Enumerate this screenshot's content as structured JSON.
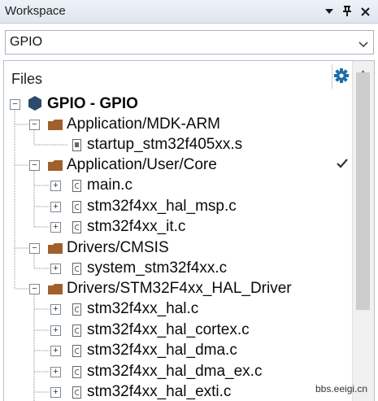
{
  "window": {
    "title": "Workspace"
  },
  "selector": {
    "value": "GPIO"
  },
  "tree": {
    "header": "Files",
    "root": "GPIO - GPIO",
    "groups": [
      {
        "label": "Application/MDK-ARM",
        "files": [
          "startup_stm32f405xx.s"
        ]
      },
      {
        "label": "Application/User/Core",
        "files": [
          "main.c",
          "stm32f4xx_hal_msp.c",
          "stm32f4xx_it.c"
        ]
      },
      {
        "label": "Drivers/CMSIS",
        "files": [
          "system_stm32f4xx.c"
        ]
      },
      {
        "label": "Drivers/STM32F4xx_HAL_Driver",
        "files": [
          "stm32f4xx_hal.c",
          "stm32f4xx_hal_cortex.c",
          "stm32f4xx_hal_dma.c",
          "stm32f4xx_hal_dma_ex.c",
          "stm32f4xx_hal_exti.c"
        ]
      }
    ]
  },
  "watermark": "bbs.eeigi.cn"
}
